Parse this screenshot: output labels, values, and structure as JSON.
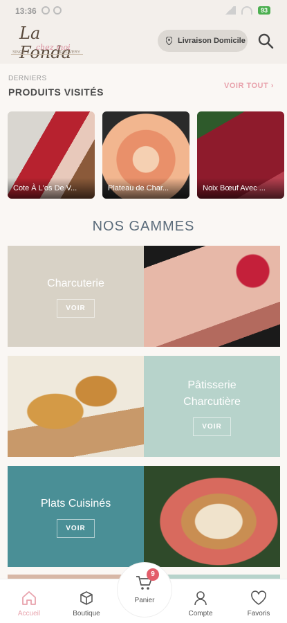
{
  "status": {
    "time": "13:36",
    "battery": "93"
  },
  "header": {
    "logo_name": "La Fonda",
    "logo_sub": "chez moi",
    "logo_tag_left": "SINCE",
    "logo_tag_right": "DELIVERY",
    "delivery_label": "Livraison Domicile"
  },
  "recent": {
    "label": "DERNIERS",
    "title": "PRODUITS VISITÉS",
    "see_all": "VOIR TOUT",
    "products": [
      {
        "name": "Cote À L'os De V..."
      },
      {
        "name": "Plateau de Char..."
      },
      {
        "name": "Noix Bœuf Avec ..."
      }
    ]
  },
  "ranges": {
    "title": "NOS GAMMES",
    "items": [
      {
        "name": "Charcuterie",
        "cta": "VOIR",
        "color": "#d8d2c6"
      },
      {
        "name": "Pâtisserie Charcutière",
        "cta": "VOIR",
        "color": "#b7d3cb"
      },
      {
        "name": "Plats Cuisinés",
        "cta": "VOIR",
        "color": "#4a8f96"
      }
    ]
  },
  "bottom_nav": {
    "items": [
      {
        "label": "Accueil",
        "icon": "home-icon",
        "active": true
      },
      {
        "label": "Boutique",
        "icon": "box-icon"
      },
      {
        "label": "Panier",
        "icon": "cart-icon",
        "badge": "9"
      },
      {
        "label": "Compte",
        "icon": "user-icon"
      },
      {
        "label": "Favoris",
        "icon": "heart-icon"
      }
    ]
  },
  "colors": {
    "accent": "#e8a2ac",
    "title": "#5a6b7a",
    "header_bg": "#f3efeb"
  }
}
